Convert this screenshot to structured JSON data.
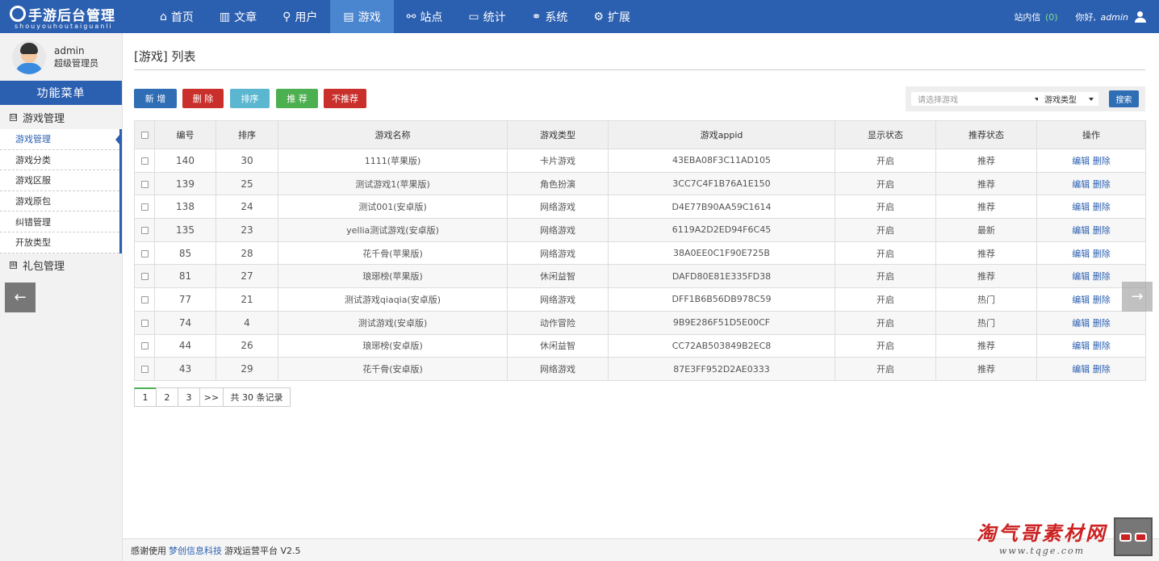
{
  "brand": {
    "title": "手游后台管理",
    "subtitle": "shouyouhoutaiguanli"
  },
  "nav": [
    {
      "label": "首页",
      "icon": "home-icon",
      "glyph": "⌂"
    },
    {
      "label": "文章",
      "icon": "bar-chart-icon",
      "glyph": "▥"
    },
    {
      "label": "用户",
      "icon": "user-icon",
      "glyph": "⚲"
    },
    {
      "label": "游戏",
      "icon": "book-icon",
      "glyph": "▤"
    },
    {
      "label": "站点",
      "icon": "share-icon",
      "glyph": "⚯"
    },
    {
      "label": "统计",
      "icon": "monitor-icon",
      "glyph": "▭"
    },
    {
      "label": "系统",
      "icon": "link-icon",
      "glyph": "⚭"
    },
    {
      "label": "扩展",
      "icon": "gear-icon",
      "glyph": "⚙"
    }
  ],
  "top_right": {
    "messages_label": "站内信",
    "messages_count": "(0)",
    "hello": "你好,",
    "username": "admin"
  },
  "sidebar": {
    "user_name": "admin",
    "user_role": "超级管理员",
    "menu_title": "功能菜单",
    "groups": [
      {
        "label": "游戏管理",
        "toggle": "⊟",
        "items": [
          "游戏管理",
          "游戏分类",
          "游戏区服",
          "游戏原包",
          "纠错管理",
          "开放类型"
        ]
      },
      {
        "label": "礼包管理",
        "toggle": "⊞"
      }
    ]
  },
  "page": {
    "title": "[游戏] 列表",
    "buttons": {
      "add": "新 增",
      "delete": "删 除",
      "sort": "排序",
      "recommend": "推 荐",
      "unrecommend": "不推荐"
    },
    "filter": {
      "game_placeholder": "请选择游戏",
      "type_value": "游戏类型",
      "search": "搜索"
    }
  },
  "table": {
    "headers": [
      "编号",
      "排序",
      "游戏名称",
      "游戏类型",
      "游戏appid",
      "显示状态",
      "推荐状态",
      "操作"
    ],
    "rows": [
      {
        "id": "140",
        "sort": "30",
        "name": "1111(苹果版)",
        "type": "卡片游戏",
        "appid": "43EBA08F3C11AD105",
        "show": "开启",
        "rec": "推荐"
      },
      {
        "id": "139",
        "sort": "25",
        "name": "测试游戏1(苹果版)",
        "type": "角色扮演",
        "appid": "3CC7C4F1B76A1E150",
        "show": "开启",
        "rec": "推荐"
      },
      {
        "id": "138",
        "sort": "24",
        "name": "测试001(安卓版)",
        "type": "网络游戏",
        "appid": "D4E77B90AA59C1614",
        "show": "开启",
        "rec": "推荐"
      },
      {
        "id": "135",
        "sort": "23",
        "name": "yellia测试游戏(安卓版)",
        "type": "网络游戏",
        "appid": "6119A2D2ED94F6C45",
        "show": "开启",
        "rec": "最新"
      },
      {
        "id": "85",
        "sort": "28",
        "name": "花千骨(苹果版)",
        "type": "网络游戏",
        "appid": "38A0EE0C1F90E725B",
        "show": "开启",
        "rec": "推荐"
      },
      {
        "id": "81",
        "sort": "27",
        "name": "琅琊榜(苹果版)",
        "type": "休闲益智",
        "appid": "DAFD80E81E335FD38",
        "show": "开启",
        "rec": "推荐"
      },
      {
        "id": "77",
        "sort": "21",
        "name": "测试游戏qiaqia(安卓版)",
        "type": "网络游戏",
        "appid": "DFF1B6B56DB978C59",
        "show": "开启",
        "rec": "热门"
      },
      {
        "id": "74",
        "sort": "4",
        "name": "测试游戏(安卓版)",
        "type": "动作冒险",
        "appid": "9B9E286F51D5E00CF",
        "show": "开启",
        "rec": "热门"
      },
      {
        "id": "44",
        "sort": "26",
        "name": "琅琊榜(安卓版)",
        "type": "休闲益智",
        "appid": "CC72AB503849B2EC8",
        "show": "开启",
        "rec": "推荐"
      },
      {
        "id": "43",
        "sort": "29",
        "name": "花千骨(安卓版)",
        "type": "网络游戏",
        "appid": "87E3FF952D2AE0333",
        "show": "开启",
        "rec": "推荐"
      }
    ],
    "op_edit": "编辑",
    "op_delete": "删除"
  },
  "pagination": {
    "pages": [
      "1",
      "2",
      "3"
    ],
    "next": ">>",
    "info": "共 30 条记录"
  },
  "footer": {
    "prefix": "感谢使用",
    "company": "梦创信息科技",
    "suffix": "游戏运营平台 V2.5"
  },
  "watermark": {
    "main": "淘气哥素材网",
    "sub": "www.tqge.com"
  },
  "arrows": {
    "back": "←",
    "forward": "→"
  }
}
